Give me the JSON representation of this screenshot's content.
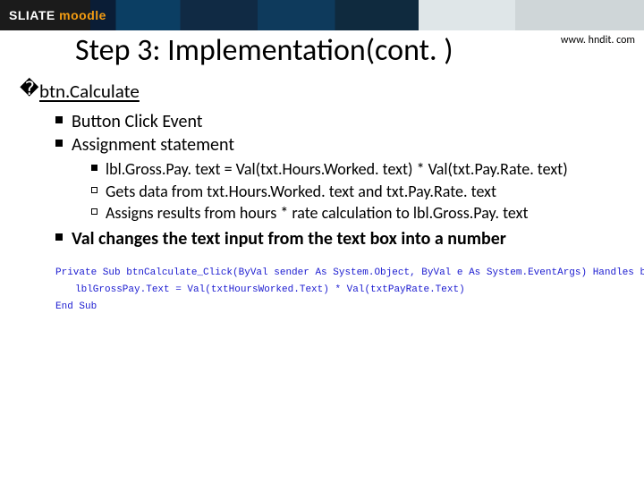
{
  "banner": {
    "brand1": "SLIATE",
    "brand2": "moodle"
  },
  "url": "www. hndit. com",
  "title": "Step 3:  Implementation(cont. )",
  "section": "btn.Calculate",
  "bullets": {
    "b1": "Button Click Event",
    "b2": "Assignment statement",
    "b2a": "lbl.Gross.Pay. text = Val(txt.Hours.Worked. text) * Val(txt.Pay.Rate. text)",
    "b2b": "Gets data from txt.Hours.Worked. text and txt.Pay.Rate. text",
    "b2c": "Assigns results from hours * rate calculation to lbl.Gross.Pay. text",
    "b3_prefix": "Val",
    "b3_rest": " changes the text input from the text box into a number"
  },
  "code": {
    "l1": "Private Sub btnCalculate_Click(ByVal sender As System.Object, ByVal e As System.EventArgs) Handles btnCalculate.Click",
    "l2": "lblGrossPay.Text = Val(txtHoursWorked.Text) * Val(txtPayRate.Text)",
    "l3": "End Sub"
  }
}
